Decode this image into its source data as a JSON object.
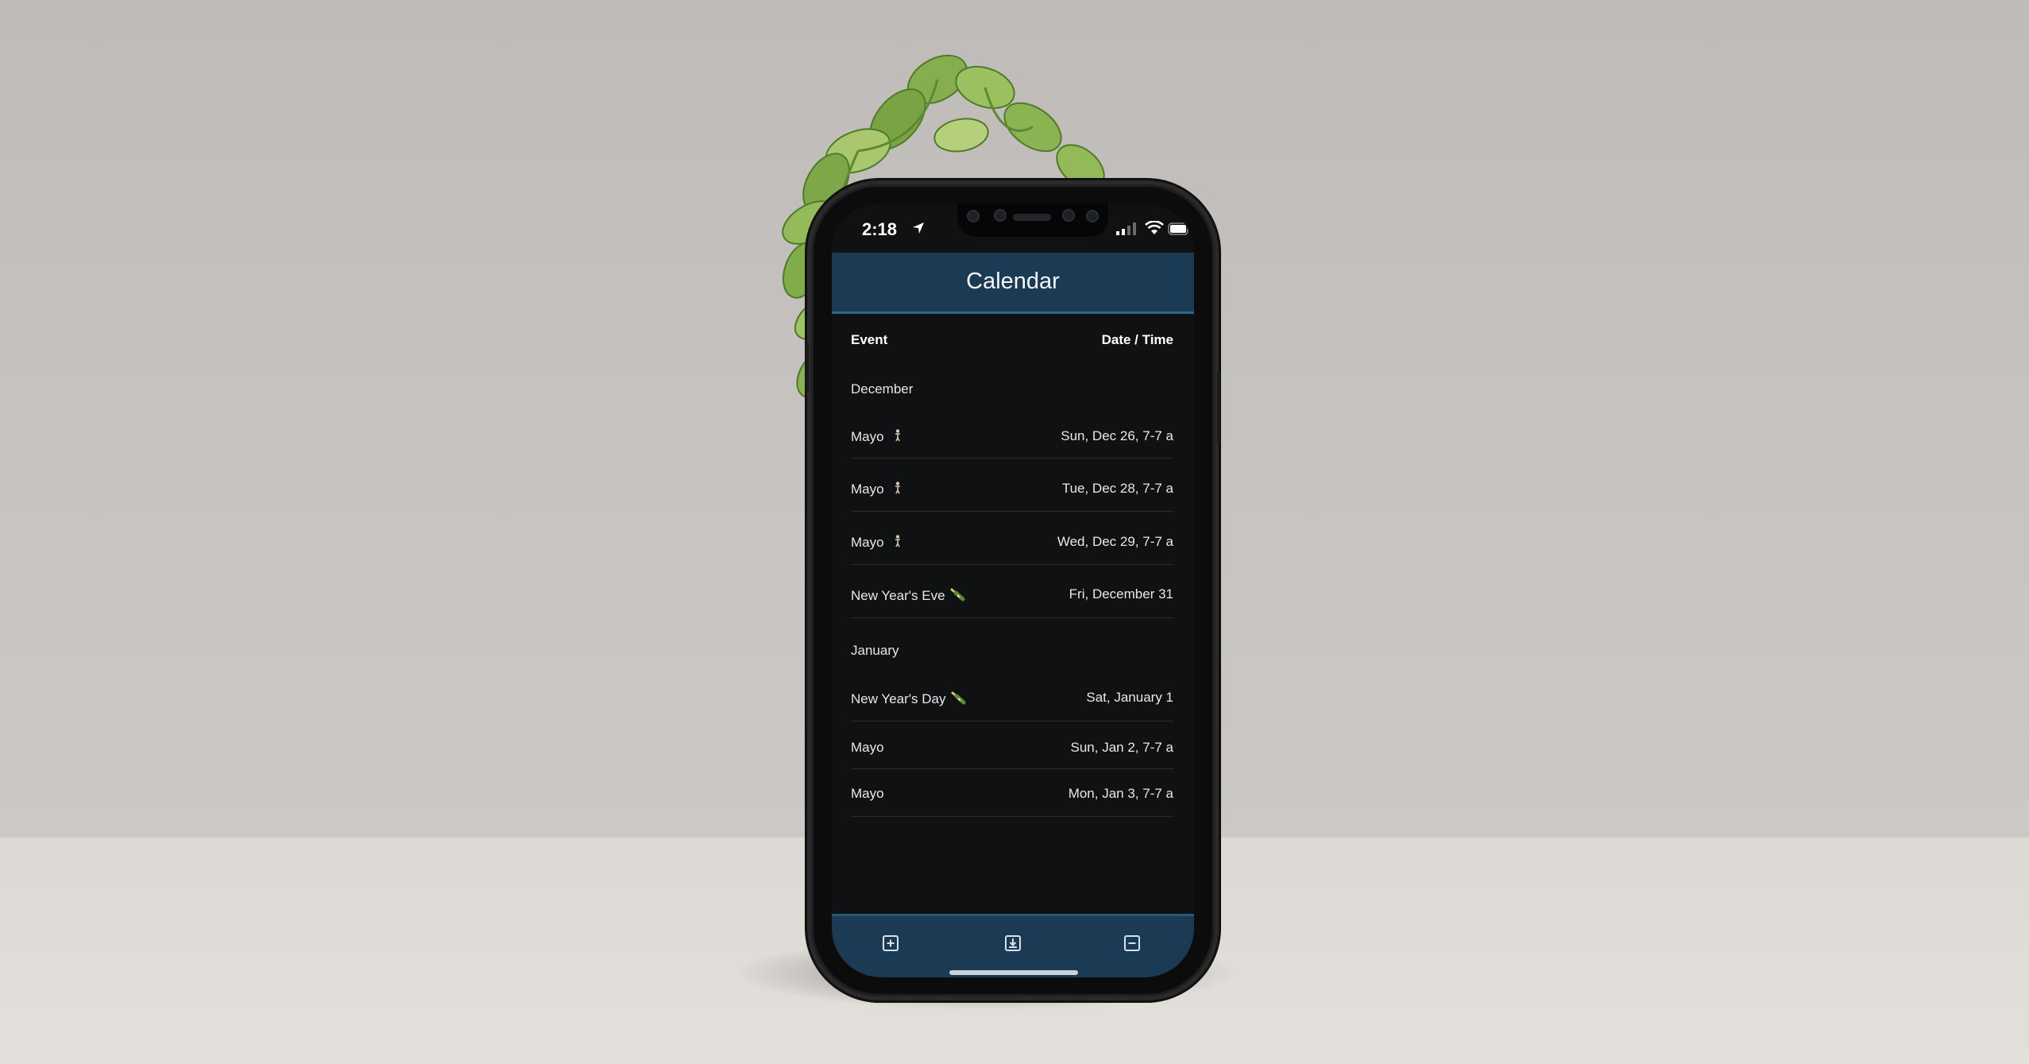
{
  "status_bar": {
    "time": "2:18"
  },
  "header": {
    "title": "Calendar"
  },
  "columns": {
    "event": "Event",
    "date_time": "Date / Time"
  },
  "months": [
    {
      "name": "December",
      "events": [
        {
          "event": "Mayo",
          "icon": "person-standing-icon",
          "date": "Sun, Dec 26, 7-7 a"
        },
        {
          "event": "Mayo",
          "icon": "person-standing-icon",
          "date": "Tue, Dec 28, 7-7 a"
        },
        {
          "event": "Mayo",
          "icon": "person-standing-icon",
          "date": "Wed, Dec 29, 7-7 a"
        },
        {
          "event": "New Year's Eve",
          "icon": "champagne-bottle-icon",
          "date": "Fri, December 31"
        }
      ]
    },
    {
      "name": "January",
      "events": [
        {
          "event": "New Year's Day",
          "icon": "champagne-bottle-icon",
          "date": "Sat, January 1"
        },
        {
          "event": "Mayo",
          "date": "Sun, Jan 2, 7-7 a"
        },
        {
          "event": "Mayo",
          "date": "Mon, Jan 3, 7-7 a"
        }
      ]
    }
  ],
  "toolbar": {
    "buttons": [
      {
        "icon": "add-square-icon"
      },
      {
        "icon": "download-square-icon"
      },
      {
        "icon": "remove-square-icon"
      }
    ]
  },
  "colors": {
    "header_bg": "#1b3a54",
    "header_accent": "#2b6b88",
    "screen_bg": "#101112",
    "text": "#e6e8ea",
    "wall": "#c3c0bd",
    "floor": "#e0ddd9"
  }
}
